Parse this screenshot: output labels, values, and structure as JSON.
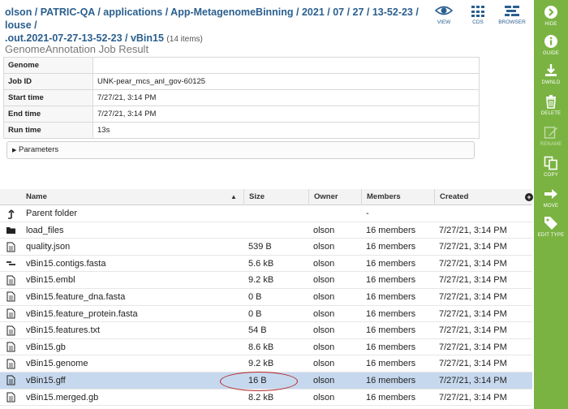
{
  "header": {
    "breadcrumb_line1": "olson / PATRIC-QA / applications / App-MetagenomeBinning / 2021 / 07 / 27 / 13-52-23 / louse /",
    "breadcrumb_line2": ".out.2021-07-27-13-52-23 / vBin15",
    "item_count": "(14 items)",
    "view_buttons": [
      {
        "label": "VIEW",
        "icon": "eye-icon"
      },
      {
        "label": "CDS",
        "icon": "cds-grid-icon"
      },
      {
        "label": "BROWSER",
        "icon": "genome-browser-icon"
      }
    ]
  },
  "job": {
    "title": "GenomeAnnotation Job Result",
    "rows": [
      {
        "key": "Genome",
        "value": ""
      },
      {
        "key": "Job ID",
        "value": "UNK-pear_mcs_anl_gov-60125"
      },
      {
        "key": "Start time",
        "value": "7/27/21, 3:14 PM"
      },
      {
        "key": "End time",
        "value": "7/27/21, 3:14 PM"
      },
      {
        "key": "Run time",
        "value": "13s"
      }
    ],
    "parameters_label": "Parameters"
  },
  "grid": {
    "columns": {
      "name": "Name",
      "size": "Size",
      "owner": "Owner",
      "members": "Members",
      "created": "Created"
    },
    "rows": [
      {
        "icon": "parent-folder-icon",
        "name": "Parent folder",
        "size": "",
        "owner": "",
        "members": "-",
        "created": ""
      },
      {
        "icon": "folder-icon",
        "name": "load_files",
        "size": "",
        "owner": "olson",
        "members": "16 members",
        "created": "7/27/21, 3:14 PM"
      },
      {
        "icon": "file-icon",
        "name": "quality.json",
        "size": "539 B",
        "owner": "olson",
        "members": "16 members",
        "created": "7/27/21, 3:14 PM"
      },
      {
        "icon": "contigs-icon",
        "name": "vBin15.contigs.fasta",
        "size": "5.6 kB",
        "owner": "olson",
        "members": "16 members",
        "created": "7/27/21, 3:14 PM"
      },
      {
        "icon": "file-icon",
        "name": "vBin15.embl",
        "size": "9.2 kB",
        "owner": "olson",
        "members": "16 members",
        "created": "7/27/21, 3:14 PM"
      },
      {
        "icon": "file-icon",
        "name": "vBin15.feature_dna.fasta",
        "size": "0 B",
        "owner": "olson",
        "members": "16 members",
        "created": "7/27/21, 3:14 PM"
      },
      {
        "icon": "file-icon",
        "name": "vBin15.feature_protein.fasta",
        "size": "0 B",
        "owner": "olson",
        "members": "16 members",
        "created": "7/27/21, 3:14 PM"
      },
      {
        "icon": "file-icon",
        "name": "vBin15.features.txt",
        "size": "54 B",
        "owner": "olson",
        "members": "16 members",
        "created": "7/27/21, 3:14 PM"
      },
      {
        "icon": "file-icon",
        "name": "vBin15.gb",
        "size": "8.6 kB",
        "owner": "olson",
        "members": "16 members",
        "created": "7/27/21, 3:14 PM"
      },
      {
        "icon": "file-icon",
        "name": "vBin15.genome",
        "size": "9.2 kB",
        "owner": "olson",
        "members": "16 members",
        "created": "7/27/21, 3:14 PM"
      },
      {
        "icon": "file-icon",
        "name": "vBin15.gff",
        "size": "16 B",
        "owner": "olson",
        "members": "16 members",
        "created": "7/27/21, 3:14 PM",
        "selected": true
      },
      {
        "icon": "file-icon",
        "name": "vBin15.merged.gb",
        "size": "8.2 kB",
        "owner": "olson",
        "members": "16 members",
        "created": "7/27/21, 3:14 PM"
      }
    ]
  },
  "sidebar": {
    "items": [
      {
        "label": "HIDE",
        "icon": "hide-arrow-icon"
      },
      {
        "label": "GUIDE",
        "icon": "info-icon"
      },
      {
        "label": "DWNLD",
        "icon": "download-icon"
      },
      {
        "label": "DELETE",
        "icon": "trash-icon"
      },
      {
        "label": "RENAME",
        "icon": "pencil-icon",
        "disabled": true
      },
      {
        "label": "COPY",
        "icon": "copy-icon"
      },
      {
        "label": "MOVE",
        "icon": "move-arrow-icon"
      },
      {
        "label": "EDIT TYPE",
        "icon": "tag-icon"
      }
    ]
  },
  "colors": {
    "sidebar_bg": "#7ab342",
    "link_blue": "#2a5f8f",
    "selected_row": "#c6d8ee",
    "highlight_ring": "#b3262a"
  }
}
